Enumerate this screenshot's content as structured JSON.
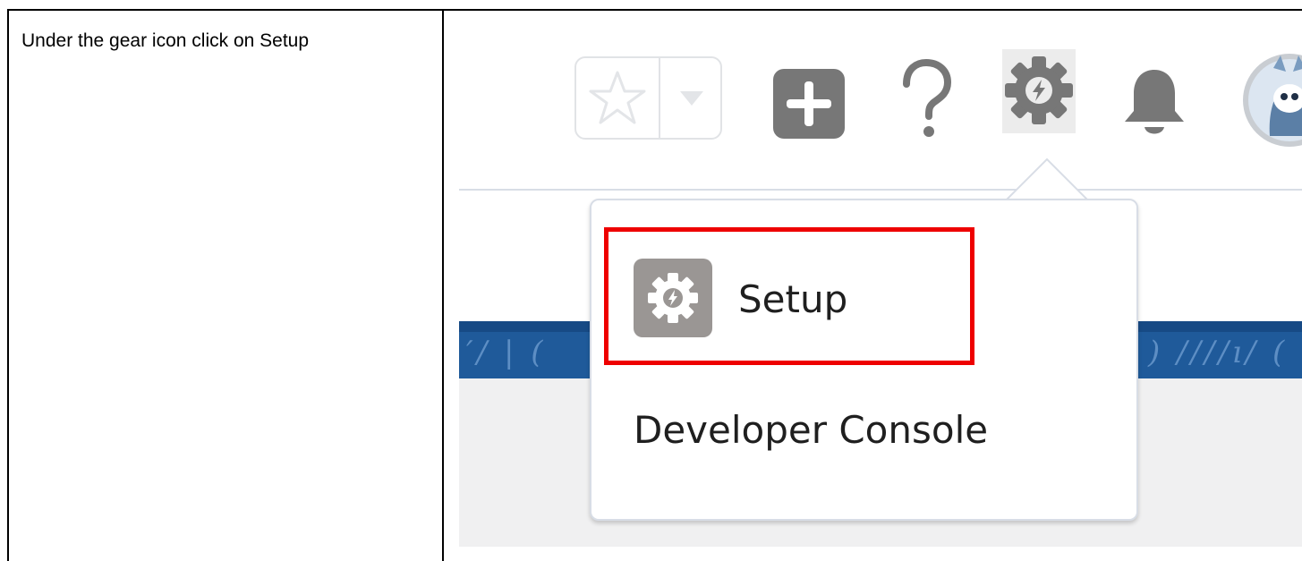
{
  "instruction": "Under the gear icon click on Setup",
  "header": {
    "icons": {
      "favorites": "star-icon",
      "favorites_menu": "chevron-down-icon",
      "global_actions": "plus-icon",
      "help": "question-mark-icon",
      "setup": "gear-lightning-icon",
      "notifications": "bell-icon",
      "avatar": "user-avatar-icon"
    }
  },
  "dropdown": {
    "items": [
      {
        "label": "Setup",
        "icon": "gear-lightning-icon"
      },
      {
        "label": "Developer Console"
      }
    ]
  },
  "colors": {
    "highlight": "#ee0000",
    "banner": "#1f5a9a",
    "icon_gray": "#777777"
  }
}
